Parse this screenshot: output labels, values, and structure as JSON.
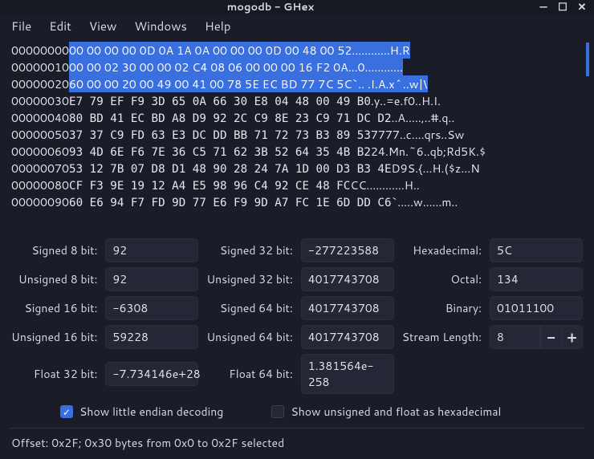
{
  "window": {
    "title": "mogodb - GHex"
  },
  "menu": {
    "file": "File",
    "edit": "Edit",
    "view": "View",
    "windows": "Windows",
    "help": "Help"
  },
  "hex": {
    "rows": [
      {
        "addr": "00000000",
        "bytes": "00 00 00 00 0D 0A 1A 0A 00 00 00 0D 00 48 00 52",
        "ascii": "............H.R",
        "sel": true
      },
      {
        "addr": "00000010",
        "bytes": "00 00 02 30 00 00 02 C4 08 06 00 00 00 16 F2 0A",
        "ascii": "...0............",
        "sel": true
      },
      {
        "addr": "00000020",
        "bytes": "60 00 00 20 00 49 00 41 00 78 5E EC BD 77 7C 5C",
        "ascii": "`.. .I.A.x^..w|\\",
        "sel": true
      },
      {
        "addr": "00000030",
        "bytes": "E7 79 EF F9 3D 65 0A 66 30 E8 04 48 00 49 B0",
        "ascii": ".y..=e.f0..H.I.",
        "sel": false
      },
      {
        "addr": "00000040",
        "bytes": "80 BD 41 EC BD A8 D9 92 2C C9 8E 23 C9 71 DC D2",
        "ascii": "..A.....,..#.q..",
        "sel": false
      },
      {
        "addr": "00000050",
        "bytes": "37 37 C9 FD 63 E3 DC DD BB 71 72 73 B3 89 53",
        "ascii": "7777..c....qrs..Sw",
        "sel": false
      },
      {
        "addr": "00000060",
        "bytes": "93 4D 6E F6 7E 36 C5 71 62 3B 52 64 35 4B B2",
        "ascii": "24.Mn.~6..qb;Rd5K.$",
        "sel": false
      },
      {
        "addr": "00000070",
        "bytes": "53 12 7B 07 D8 D1 48 90 28 24 7A 1D 00 D3 B3 4E",
        "ascii": "D9S.{...H.($z...N",
        "sel": false
      },
      {
        "addr": "00000080",
        "bytes": "CF F3 9E 19 12 A4 E5 98 96 C4 92 CE 48 FC",
        "ascii": "CC............H..",
        "sel": false
      },
      {
        "addr": "00000090",
        "bytes": "60 E6 94 F7 FD 9D 77 E6 F9 9D A7 FC 1E 6D DD C6",
        "ascii": "`.....w......m..",
        "sel": false
      }
    ]
  },
  "decoder": {
    "labels": {
      "s8": "Signed 8 bit:",
      "u8": "Unsigned 8 bit:",
      "s16": "Signed 16 bit:",
      "u16": "Unsigned 16 bit:",
      "f32": "Float 32 bit:",
      "s32": "Signed 32 bit:",
      "u32": "Unsigned 32 bit:",
      "s64": "Signed 64 bit:",
      "u64": "Unsigned 64 bit:",
      "f64": "Float 64 bit:",
      "hex": "Hexadecimal:",
      "oct": "Octal:",
      "bin": "Binary:",
      "stream": "Stream Length:"
    },
    "values": {
      "s8": "92",
      "u8": "92",
      "s16": "-6308",
      "u16": "59228",
      "f32": "-7.734146e+28",
      "s32": "-277223588",
      "u32": "4017743708",
      "s64": "4017743708",
      "u64": "4017743708",
      "f64": "1.381564e-258",
      "hex": "5C",
      "oct": "134",
      "bin": "01011100",
      "stream": "8"
    }
  },
  "checks": {
    "little_endian": "Show little endian decoding",
    "unsigned_hex": "Show unsigned and float as hexadecimal"
  },
  "status": {
    "text": "Offset: 0x2F; 0x30 bytes from 0x0 to 0x2F selected"
  }
}
